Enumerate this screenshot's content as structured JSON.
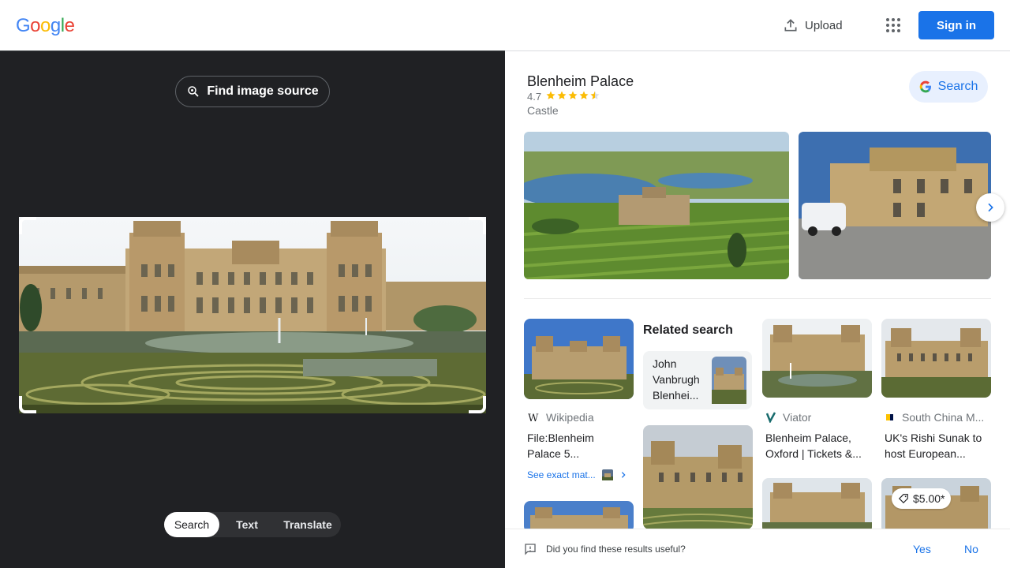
{
  "header": {
    "logo_letters": [
      "G",
      "o",
      "o",
      "g",
      "l",
      "e"
    ],
    "upload_label": "Upload",
    "signin_label": "Sign in"
  },
  "left": {
    "find_source_label": "Find image source",
    "tabs": [
      {
        "label": "Search",
        "active": true
      },
      {
        "label": "Text",
        "active": false
      },
      {
        "label": "Translate",
        "active": false
      }
    ]
  },
  "knowledge_panel": {
    "title": "Blenheim Palace",
    "rating": "4.7",
    "rating_value": 4.7,
    "rating_max": 5,
    "type": "Castle",
    "search_label": "Search"
  },
  "results": {
    "related_title": "Related search",
    "related_card_text": "John Vanbrugh Blenhei...",
    "items": [
      {
        "source": "Wikipedia",
        "title": "File:Blenheim Palace 5..."
      },
      {
        "source": "Viator",
        "title": "Blenheim Palace, Oxford | Tickets &..."
      },
      {
        "source": "South China M...",
        "title": "UK's Rishi Sunak to host European..."
      }
    ],
    "exact_match_label": "See exact mat...",
    "price": "$5.00*"
  },
  "feedback": {
    "question": "Did you find these results useful?",
    "yes": "Yes",
    "no": "No"
  },
  "colors": {
    "accent": "#1a73e8",
    "dark_bg": "#202124",
    "star": "#fbbc04"
  }
}
